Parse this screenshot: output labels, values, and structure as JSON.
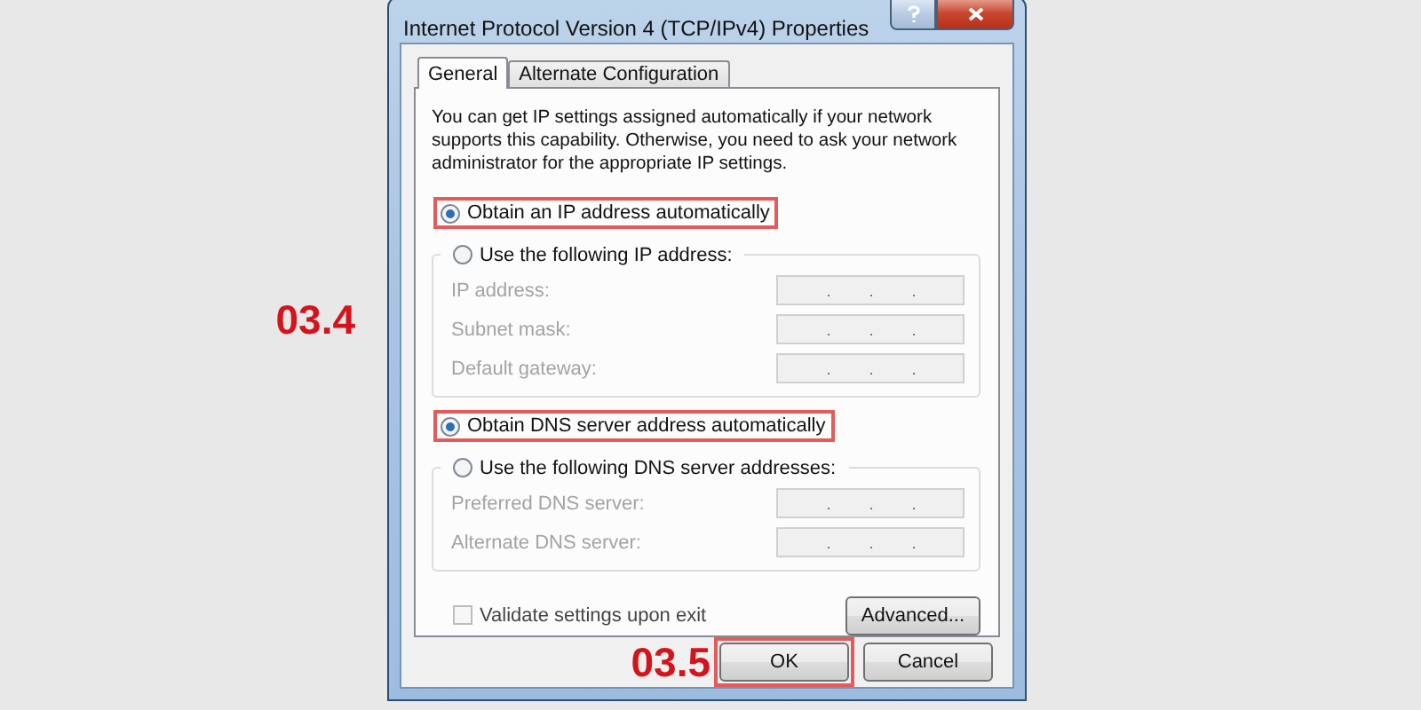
{
  "annotations": [
    "03.4",
    "03.5"
  ],
  "window": {
    "title": "Internet Protocol Version 4 (TCP/IPv4) Properties"
  },
  "tabs": [
    {
      "label": "General",
      "selected": true
    },
    {
      "label": "Alternate Configuration",
      "selected": false
    }
  ],
  "description": "You can get IP settings assigned automatically if your network supports this capability. Otherwise, you need to ask your network administrator for the appropriate IP settings.",
  "ip_section": {
    "auto_option": {
      "label": "Obtain an IP address automatically",
      "selected": true,
      "highlighted": true
    },
    "manual_option": {
      "label": "Use the following IP address:",
      "selected": false,
      "highlighted": false
    },
    "fields": [
      {
        "label": "IP address:",
        "disabled": true
      },
      {
        "label": "Subnet mask:",
        "disabled": true
      },
      {
        "label": "Default gateway:",
        "disabled": true
      }
    ]
  },
  "dns_section": {
    "auto_option": {
      "label": "Obtain DNS server address automatically",
      "selected": true,
      "highlighted": true
    },
    "manual_option": {
      "label": "Use the following DNS server addresses:",
      "selected": false,
      "highlighted": false
    },
    "fields": [
      {
        "label": "Preferred DNS server:",
        "disabled": true
      },
      {
        "label": "Alternate DNS server:",
        "disabled": true
      }
    ]
  },
  "validate": {
    "label": "Validate settings upon exit",
    "checked": false
  },
  "advanced_button": "Advanced...",
  "buttons": [
    {
      "label": "OK",
      "highlighted": true
    },
    {
      "label": "Cancel",
      "highlighted": false
    }
  ]
}
